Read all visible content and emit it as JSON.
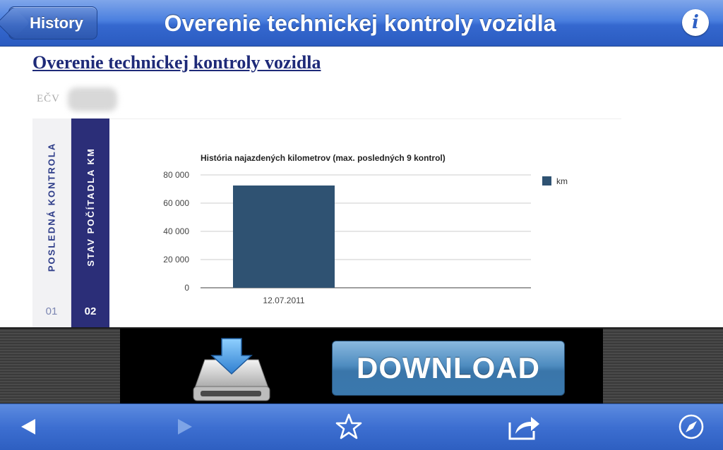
{
  "navbar": {
    "back_label": "History",
    "title": "Overenie technickej kontroly vozidla",
    "info_icon": "info-icon"
  },
  "page": {
    "heading": "Overenie technickej kontroly vozidla",
    "ecv_label": "EČV"
  },
  "tabs": [
    {
      "label": "POSLEDNÁ KONTROLA",
      "number": "01",
      "active": false
    },
    {
      "label": "STAV POČÍTADLA KM",
      "number": "02",
      "active": true
    }
  ],
  "chart_data": {
    "type": "bar",
    "title": "História najazdených kilometrov (max. posledných 9 kontrol)",
    "categories": [
      "12.07.2011"
    ],
    "series": [
      {
        "name": "km",
        "values": [
          72500
        ],
        "color": "#2f5272"
      }
    ],
    "ylim": [
      0,
      80000
    ],
    "yticks": [
      "0",
      "20 000",
      "40 000",
      "60 000",
      "80 000"
    ],
    "ytick_values": [
      0,
      20000,
      40000,
      60000,
      80000
    ],
    "xlabel": "",
    "ylabel": "",
    "grid": true,
    "legend_position": "top-right"
  },
  "ad": {
    "button_label": "DOWNLOAD",
    "icon": "download-drive-icon"
  },
  "toolbar": {
    "items": [
      {
        "name": "back-arrow-icon",
        "enabled": true
      },
      {
        "name": "forward-arrow-icon",
        "enabled": false
      },
      {
        "name": "star-icon",
        "enabled": true
      },
      {
        "name": "share-icon",
        "enabled": true
      },
      {
        "name": "compass-icon",
        "enabled": true
      }
    ]
  },
  "colors": {
    "navbar": "#3d6fd1",
    "heading": "#1e2a78",
    "active_tab": "#2b2e78",
    "bar": "#2f5272"
  }
}
